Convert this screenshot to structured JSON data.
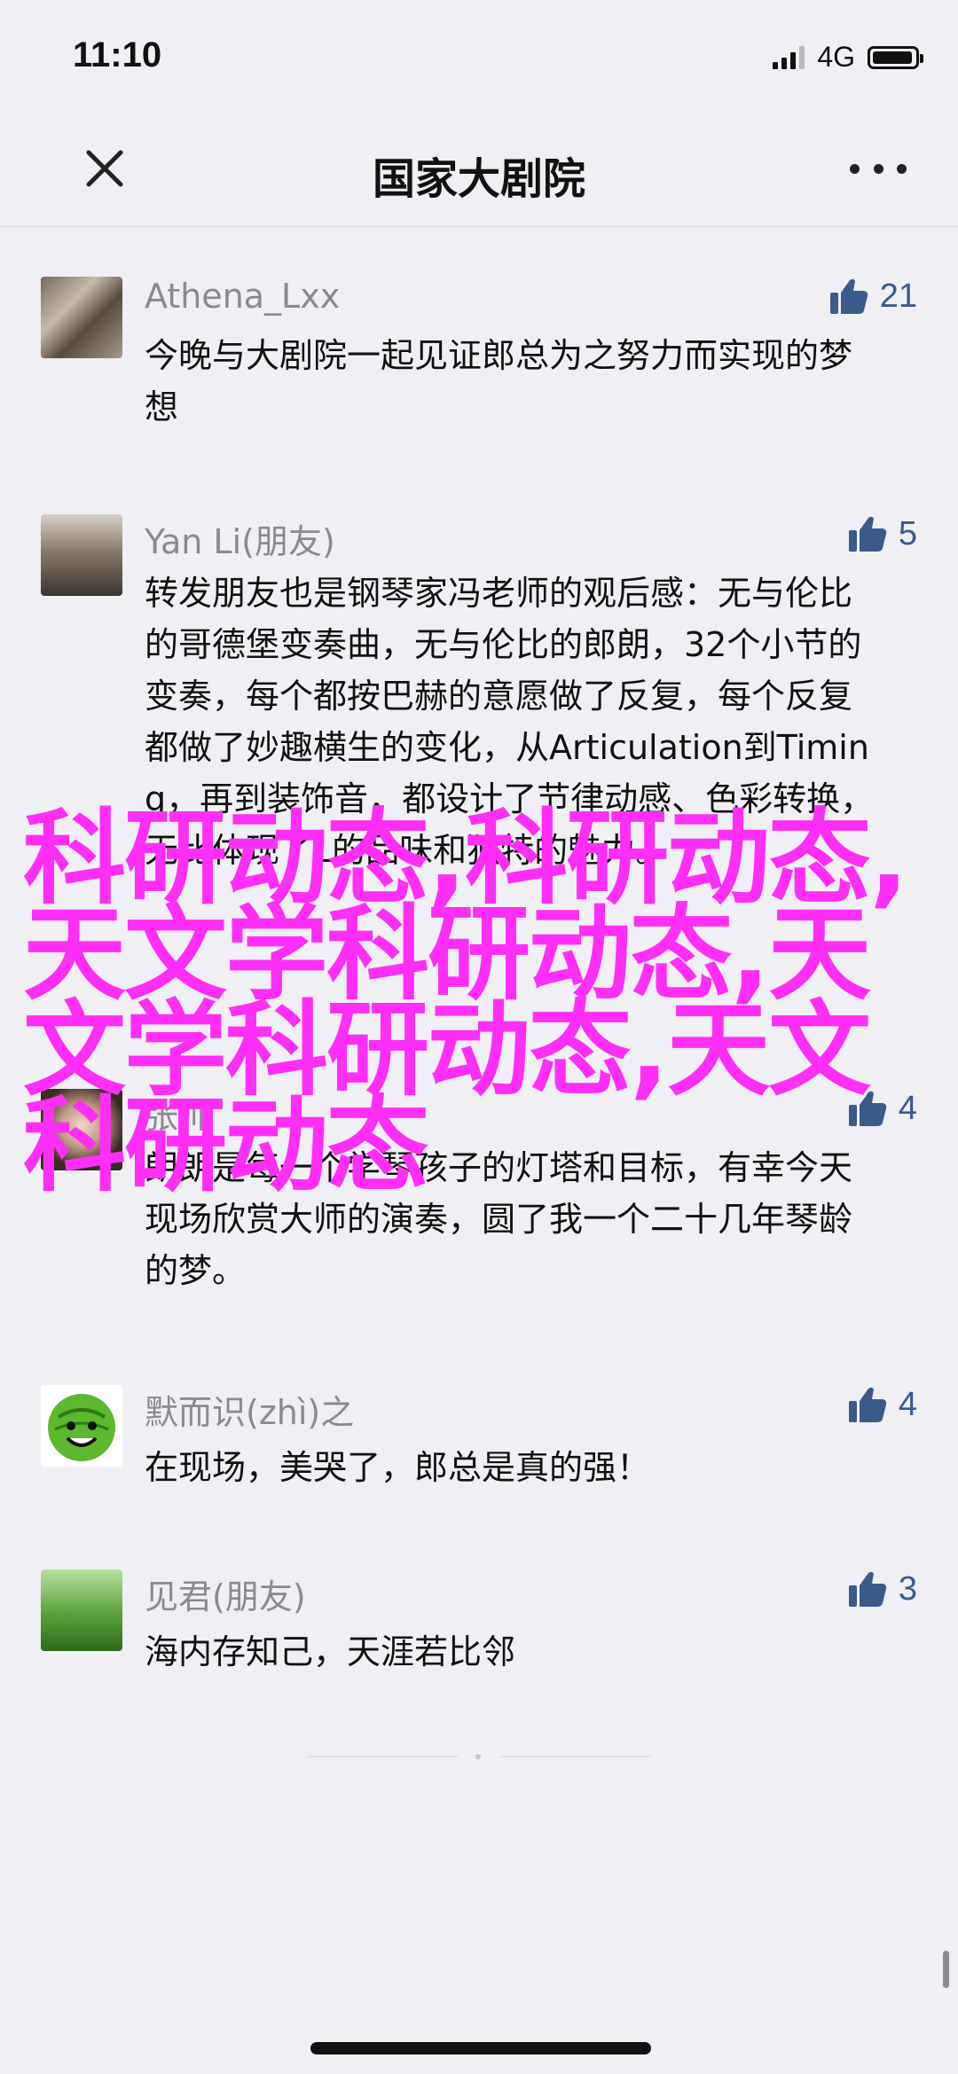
{
  "status_bar": {
    "time": "11:10",
    "network": "4G"
  },
  "nav": {
    "title": "国家大剧院"
  },
  "comments": [
    {
      "name": "Athena_Lxx",
      "text": "今晚与大剧院一起见证郎总为之努力而实现的梦想",
      "likes": "21"
    },
    {
      "name": "Yan Li(朋友)",
      "text": "转发朋友也是钢琴家冯老师的观后感：无与伦比的哥德堡变奏曲，无与伦比的郎朗，32个小节的变奏，每个都按巴赫的意愿做了反复，每个反复都做了妙趣横生的变化，从Articulation到Timing，再到装饰音，都设计了节律动感、色彩转换，无比体现了L的品味和独特的魅力。",
      "likes": "5"
    },
    {
      "name": "张帅",
      "text": "朗朗是每一个学琴孩子的灯塔和目标，有幸今天现场欣赏大师的演奏，圆了我一个二十几年琴龄的梦。",
      "likes": "4"
    },
    {
      "name": "默而识(zhì)之",
      "text": "在现场，美哭了，郎总是真的强！",
      "likes": "4"
    },
    {
      "name": "见君(朋友)",
      "text": "海内存知己，天涯若比邻",
      "likes": "3"
    }
  ],
  "overlay": {
    "text": "科研动态,科研动态,天文学科研动态,天文学科研动态,天文科研动态"
  },
  "colors": {
    "background": "#efeff4",
    "name_gray": "#8a8a8e",
    "like_blue": "#3a5a8c",
    "overlay_magenta": "#ff2ef7"
  }
}
